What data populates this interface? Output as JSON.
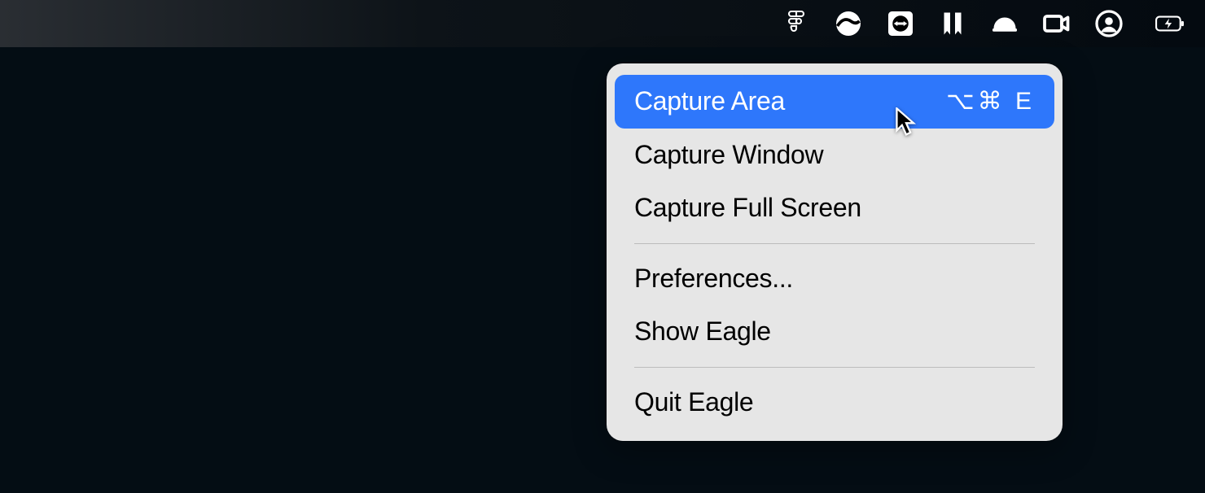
{
  "menubar": {
    "icons": [
      {
        "name": "figma-icon"
      },
      {
        "name": "browser-icon"
      },
      {
        "name": "teamviewer-icon"
      },
      {
        "name": "bookmark-icon"
      },
      {
        "name": "hardhat-icon"
      },
      {
        "name": "camera-icon"
      },
      {
        "name": "user-icon"
      },
      {
        "name": "battery-icon"
      }
    ]
  },
  "menu": {
    "items": [
      {
        "label": "Capture Area",
        "shortcut": "⌥⌘ E",
        "highlighted": true
      },
      {
        "label": "Capture Window"
      },
      {
        "label": "Capture Full Screen"
      },
      {
        "separator": true
      },
      {
        "label": "Preferences..."
      },
      {
        "label": "Show Eagle"
      },
      {
        "separator": true
      },
      {
        "label": "Quit Eagle"
      }
    ]
  }
}
